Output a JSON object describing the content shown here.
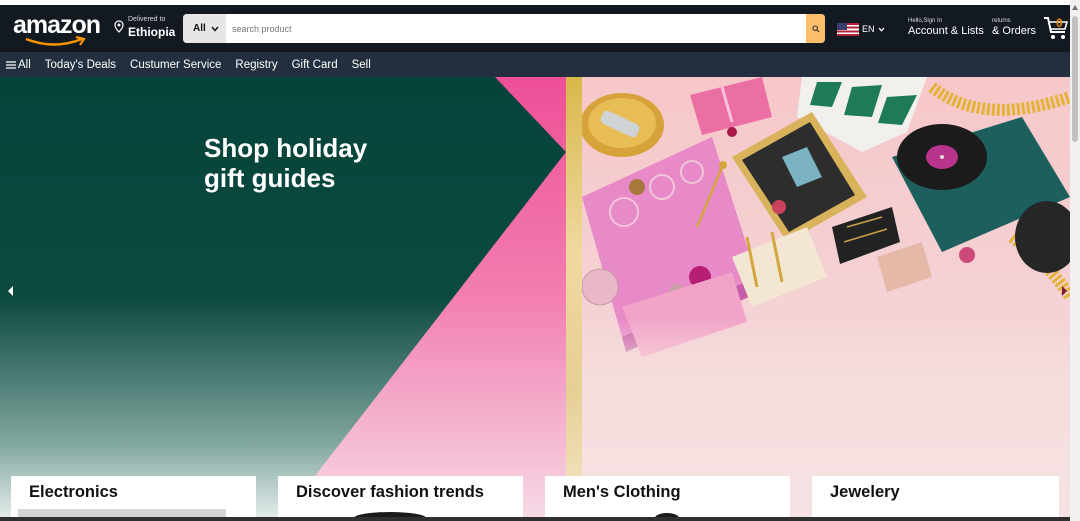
{
  "header": {
    "logo": "amazon",
    "deliver_line1": "Delivered to",
    "deliver_line2": "Ethiopia",
    "search_category": "All",
    "search_placeholder": "search product",
    "language": "EN",
    "account_line1": "Hello,Sign In",
    "account_line2": "Account & Lists",
    "orders_line1": "returns",
    "orders_line2": "& Orders",
    "cart_count": "0"
  },
  "subnav": {
    "all": "All",
    "items": [
      "Today's Deals",
      "Custumer Service",
      "Registry",
      "Gift Card",
      "Sell"
    ]
  },
  "hero": {
    "title_line1": "Shop holiday",
    "title_line2": "gift guides"
  },
  "cards": [
    {
      "title": "Electronics"
    },
    {
      "title": "Discover fashion trends"
    },
    {
      "title": "Men's Clothing"
    },
    {
      "title": "Jewelery"
    }
  ],
  "colors": {
    "nav_bg": "#131921",
    "subnav_bg": "#232f3e",
    "search_button": "#febd69",
    "hero_green": "#06433a",
    "hero_pink": "#ee4f97"
  },
  "icons": [
    "location-pin-icon",
    "chevron-down-icon",
    "search-icon",
    "us-flag-icon",
    "cart-icon",
    "hamburger-menu-icon",
    "carousel-prev-icon",
    "carousel-next-icon"
  ]
}
